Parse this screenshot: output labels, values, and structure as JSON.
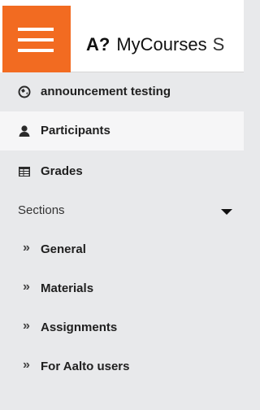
{
  "header": {
    "logo": "A?",
    "title": "MyCourses",
    "trailing": "S"
  },
  "colors": {
    "accent": "#f26b21",
    "sidebar_bg": "#e8e9eb",
    "active_bg": "#f6f6f7"
  },
  "nav": {
    "items": [
      {
        "label": "announcement testing",
        "icon": "course-icon",
        "active": false
      },
      {
        "label": "Participants",
        "icon": "participants-icon",
        "active": true
      },
      {
        "label": "Grades",
        "icon": "grades-icon",
        "active": false
      }
    ],
    "sections": {
      "label": "Sections",
      "expanded": true,
      "items": [
        {
          "label": "General",
          "icon": "chevron-right-icon"
        },
        {
          "label": "Materials",
          "icon": "chevron-right-icon"
        },
        {
          "label": "Assignments",
          "icon": "chevron-right-icon"
        },
        {
          "label": "For Aalto users",
          "icon": "chevron-right-icon"
        }
      ]
    }
  }
}
